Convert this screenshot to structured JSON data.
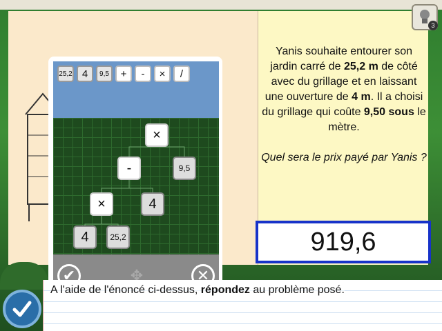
{
  "hint": {
    "count": "3"
  },
  "problem": {
    "t1": "Yanis souhaite entourer son jardin carré de ",
    "b1": "25,2 m",
    "t2": " de côté avec du grillage et en laissant une ouverture de ",
    "b2": "4 m",
    "t3": ". Il a choisi du grillage qui coûte ",
    "b3": "9,50 sous",
    "t4": " le mètre."
  },
  "question": "Quel sera le prix payé par Yanis ?",
  "answer": "919,6",
  "calculator": {
    "tokens": [
      "25,2",
      "4",
      "9,5",
      "+",
      "-",
      "×",
      "/"
    ],
    "tree": {
      "root": "×",
      "minus": "-",
      "n95": "9,5",
      "times": "×",
      "n4a": "4",
      "n4b": "4",
      "n252": "25,2"
    },
    "ok_icon": "check-icon",
    "cancel_icon": "cross-icon",
    "move_icon": "move-arrows-icon"
  },
  "instruction": {
    "t1": "A l'aide de l'énoncé ci-dessus, ",
    "b1": "répondez",
    "t2": " au problème posé."
  },
  "colors": {
    "answer_border": "#1733c9",
    "validate": "#2a6ea8"
  }
}
